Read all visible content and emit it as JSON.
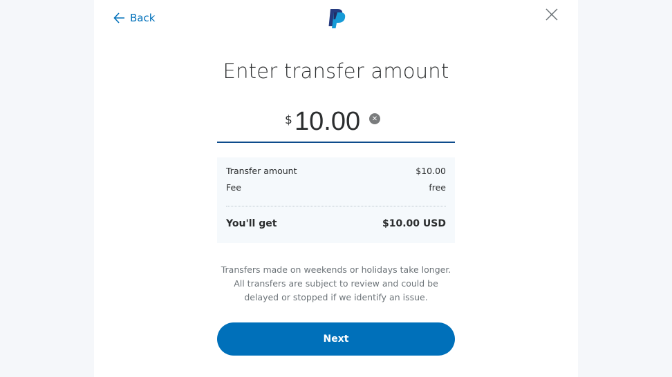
{
  "header": {
    "back_label": "Back",
    "logo_icon": "paypal-logo-icon",
    "close_icon": "close-icon"
  },
  "title": "Enter transfer amount",
  "amount": {
    "currency_symbol": "$",
    "value": "10.00",
    "clear_icon": "clear-icon"
  },
  "summary": {
    "rows": [
      {
        "label": "Transfer amount",
        "value": "$10.00"
      },
      {
        "label": "Fee",
        "value": "free"
      }
    ],
    "total_label": "You'll get",
    "total_value": "$10.00 USD"
  },
  "notice": "Transfers made on weekends or holidays take longer. All transfers are subject to review and could be delayed or stopped if we identify an issue.",
  "next_label": "Next",
  "colors": {
    "accent": "#0070ba",
    "underline": "#0e4c8c",
    "background": "#f5f7fa",
    "summary_bg": "#f5f9fc"
  }
}
